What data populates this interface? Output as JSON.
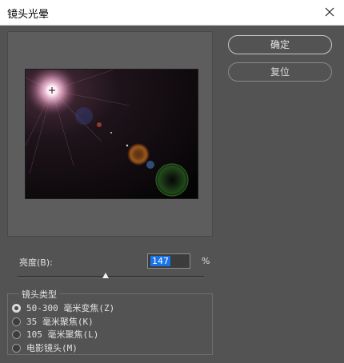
{
  "window": {
    "title": "镜头光晕"
  },
  "buttons": {
    "ok": "确定",
    "reset": "复位"
  },
  "brightness": {
    "label": "亮度(B):",
    "value": "147",
    "unit": "%",
    "slider_level_percent": 47
  },
  "lens_type": {
    "title": "镜头类型",
    "options": [
      {
        "label": "50-300 毫米变焦(Z)",
        "checked": true
      },
      {
        "label": "35 毫米聚焦(K)",
        "checked": false
      },
      {
        "label": "105 毫米聚焦(L)",
        "checked": false
      },
      {
        "label": "电影镜头(M)",
        "checked": false
      }
    ]
  },
  "icons": {
    "close": "close-icon",
    "flare_center": "crosshair-icon"
  }
}
